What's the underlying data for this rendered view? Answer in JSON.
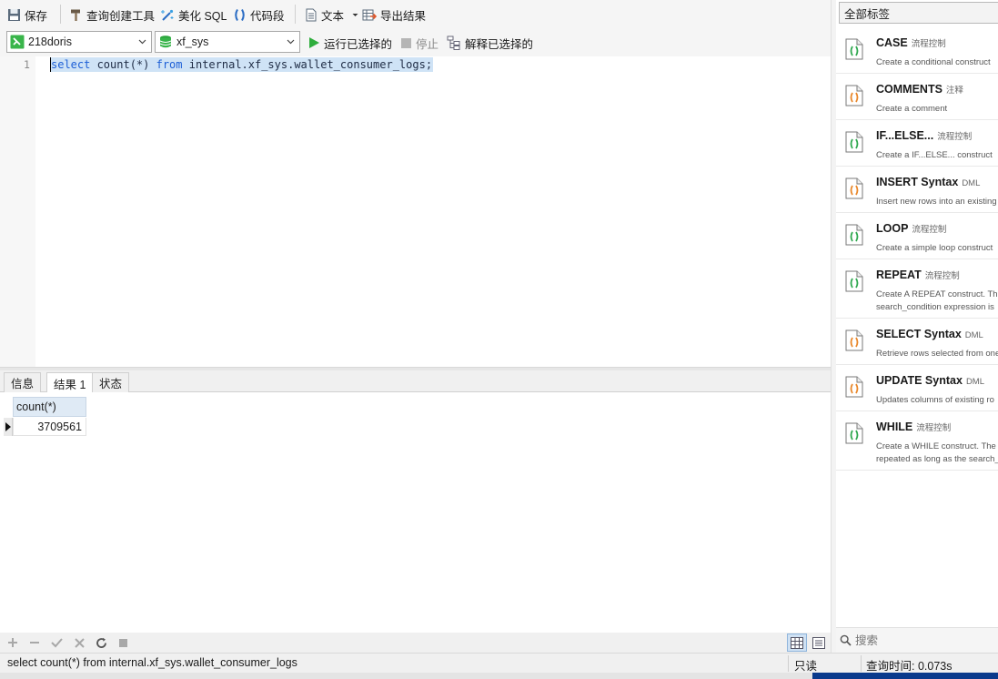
{
  "toolbar": {
    "save": "保存",
    "query_builder": "查询创建工具",
    "beautify": "美化 SQL",
    "snippet": "代码段",
    "text": "文本",
    "export": "导出结果"
  },
  "connection_bar": {
    "connection": "218doris",
    "database": "xf_sys",
    "run_selected": "运行已选择的",
    "stop": "停止",
    "explain_selected": "解释已选择的"
  },
  "editor": {
    "line_number": "1",
    "tokens": {
      "kw_select": "select",
      "count": " count(*) ",
      "kw_from": "from",
      "table": " internal.xf_sys.wallet_consumer_logs;"
    }
  },
  "result_tabs": [
    {
      "label": "信息",
      "active": false
    },
    {
      "label": "结果 1",
      "active": true
    },
    {
      "label": "状态",
      "active": false
    }
  ],
  "result_grid": {
    "columns": [
      "count(*)"
    ],
    "rows": [
      [
        "3709561"
      ]
    ]
  },
  "status_bar": {
    "query": "select count(*) from internal.xf_sys.wallet_consumer_logs",
    "mode": "只读",
    "query_time": "查询时间: 0.073s"
  },
  "snippets_panel": {
    "filter": "全部标签",
    "search_placeholder": "搜索",
    "items": [
      {
        "title": "CASE",
        "category": "流程控制",
        "desc1": "Create a conditional construct",
        "desc2": "",
        "icon_color": "#2fa84f"
      },
      {
        "title": "COMMENTS",
        "category": "注释",
        "desc1": "Create a comment",
        "desc2": "",
        "icon_color": "#e9872a"
      },
      {
        "title": "IF...ELSE...",
        "category": "流程控制",
        "desc1": "Create a IF...ELSE... construct",
        "desc2": "",
        "icon_color": "#2fa84f"
      },
      {
        "title": "INSERT Syntax",
        "category": "DML",
        "desc1": "Insert new rows into an existing",
        "desc2": "",
        "icon_color": "#e9872a"
      },
      {
        "title": "LOOP",
        "category": "流程控制",
        "desc1": "Create a simple loop construct",
        "desc2": "",
        "icon_color": "#2fa84f"
      },
      {
        "title": "REPEAT",
        "category": "流程控制",
        "desc1": "Create A REPEAT construct. The",
        "desc2": "search_condition expression is",
        "icon_color": "#2fa84f"
      },
      {
        "title": "SELECT Syntax",
        "category": "DML",
        "desc1": "Retrieve rows selected from one",
        "desc2": "",
        "icon_color": "#e9872a"
      },
      {
        "title": "UPDATE Syntax",
        "category": "DML",
        "desc1": "Updates columns of existing ro",
        "desc2": "",
        "icon_color": "#e9872a"
      },
      {
        "title": "WHILE",
        "category": "流程控制",
        "desc1": "Create a WHILE construct. The",
        "desc2": "repeated as long as the search_",
        "icon_color": "#2fa84f"
      }
    ]
  }
}
